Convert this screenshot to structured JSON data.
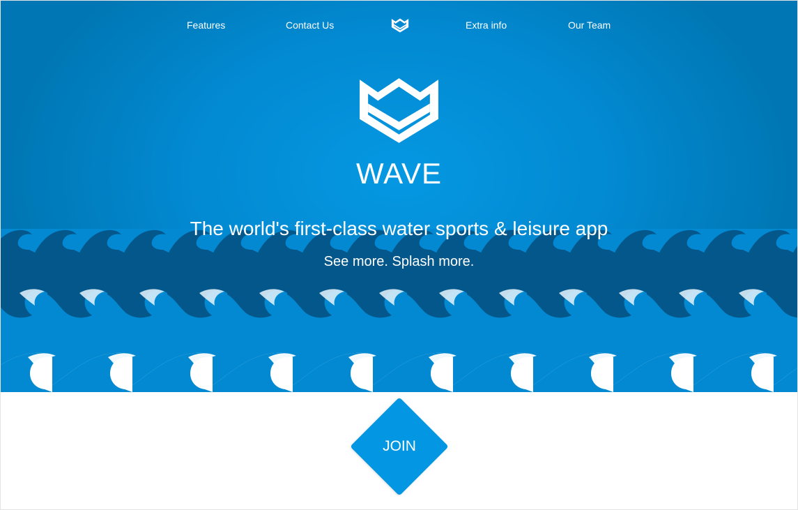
{
  "nav": {
    "links": [
      {
        "label": "Features"
      },
      {
        "label": "Contact Us"
      },
      {
        "label": "Extra info"
      },
      {
        "label": "Our Team"
      }
    ],
    "logo_icon": "wave-logo-icon"
  },
  "hero": {
    "logo_icon": "wave-logo-icon",
    "brand": "WAVE",
    "tagline": "The world's first-class water sports & leisure app",
    "subtagline": "See more. Splash more."
  },
  "cta": {
    "join_label": "JOIN"
  },
  "colors": {
    "hero_blue": "#0289d1",
    "dark_wave": "#03578a",
    "accent": "#0397e3",
    "text": "#ffffff"
  }
}
